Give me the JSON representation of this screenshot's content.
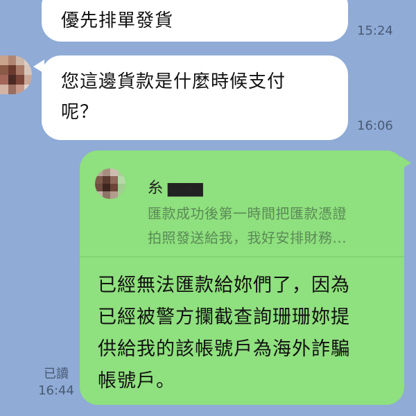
{
  "messages_in": [
    {
      "text": "優先排單發貨",
      "time": "15:24"
    },
    {
      "text_line1": "您這邊貨款是什麼時候支付",
      "text_line2": "呢？",
      "time": "16:06"
    }
  ],
  "message_out": {
    "reply_to_name": "糸 ▆▆▆",
    "reply_quote_line1": "匯款成功後第一時間把匯款憑證",
    "reply_quote_line2": "拍照發送給我，我好安排財務...",
    "text_line1": "已經無法匯款給妳們了，因為",
    "text_line2": "已經被警方攔截查詢珊珊妳提",
    "text_line3": "供給我的該帳號戶為海外詐騙",
    "text_line4": "帳號戶。",
    "read_label": "已讀",
    "time": "16:44"
  },
  "colors": {
    "background": "#8fabd6",
    "bubble_in": "#ffffff",
    "bubble_out": "#8fe07e",
    "time_text": "#4a5a73",
    "reply_quote_text": "#5a8a57"
  },
  "icons": {
    "sender_avatar": "blurred-avatar",
    "reply_avatar": "blurred-avatar"
  }
}
